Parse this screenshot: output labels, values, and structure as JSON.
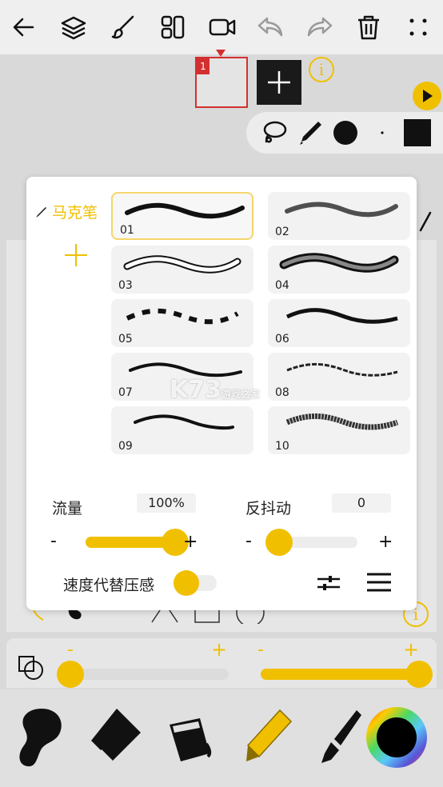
{
  "toolbar": {
    "icons": [
      "back-arrow-icon",
      "layers-icon",
      "brush-icon",
      "panels-icon",
      "video-icon",
      "undo-icon",
      "redo-icon",
      "trash-icon",
      "more-icon"
    ]
  },
  "frames": {
    "current_frame_number": "1"
  },
  "tool_strip": {
    "icons": [
      "lasso-icon",
      "pencil-icon",
      "fill-circle-icon",
      "small-dot-icon",
      "square-icon"
    ]
  },
  "brush_dialog": {
    "category_label": "马克笔",
    "brushes": [
      {
        "id": "01",
        "selected": true
      },
      {
        "id": "02",
        "selected": false
      },
      {
        "id": "03",
        "selected": false
      },
      {
        "id": "04",
        "selected": false
      },
      {
        "id": "05",
        "selected": false
      },
      {
        "id": "06",
        "selected": false
      },
      {
        "id": "07",
        "selected": false
      },
      {
        "id": "08",
        "selected": false
      },
      {
        "id": "09",
        "selected": false
      },
      {
        "id": "10",
        "selected": false
      }
    ],
    "flow_label": "流量",
    "flow_value": "100%",
    "flow_level": 1.0,
    "anti_shake_label": "反抖动",
    "anti_shake_value": "0",
    "anti_shake_level": 0.0,
    "minus": "-",
    "plus": "+",
    "speed_pressure_label": "速度代替压感",
    "speed_pressure_on": false
  },
  "size_panel": {
    "minus": "-",
    "plus": "+",
    "left_level": 0.0,
    "right_level": 1.0
  },
  "bottom_tools": [
    "blob-brush-icon",
    "eraser-icon",
    "paint-bucket-icon",
    "marker-icon",
    "fountain-pen-icon",
    "color-wheel-icon"
  ],
  "watermark": {
    "main": "K73",
    "sub": "游戏之家"
  },
  "colors": {
    "accent": "#f0c000",
    "frame_red": "#d32f2f",
    "current_color": "#000000"
  }
}
